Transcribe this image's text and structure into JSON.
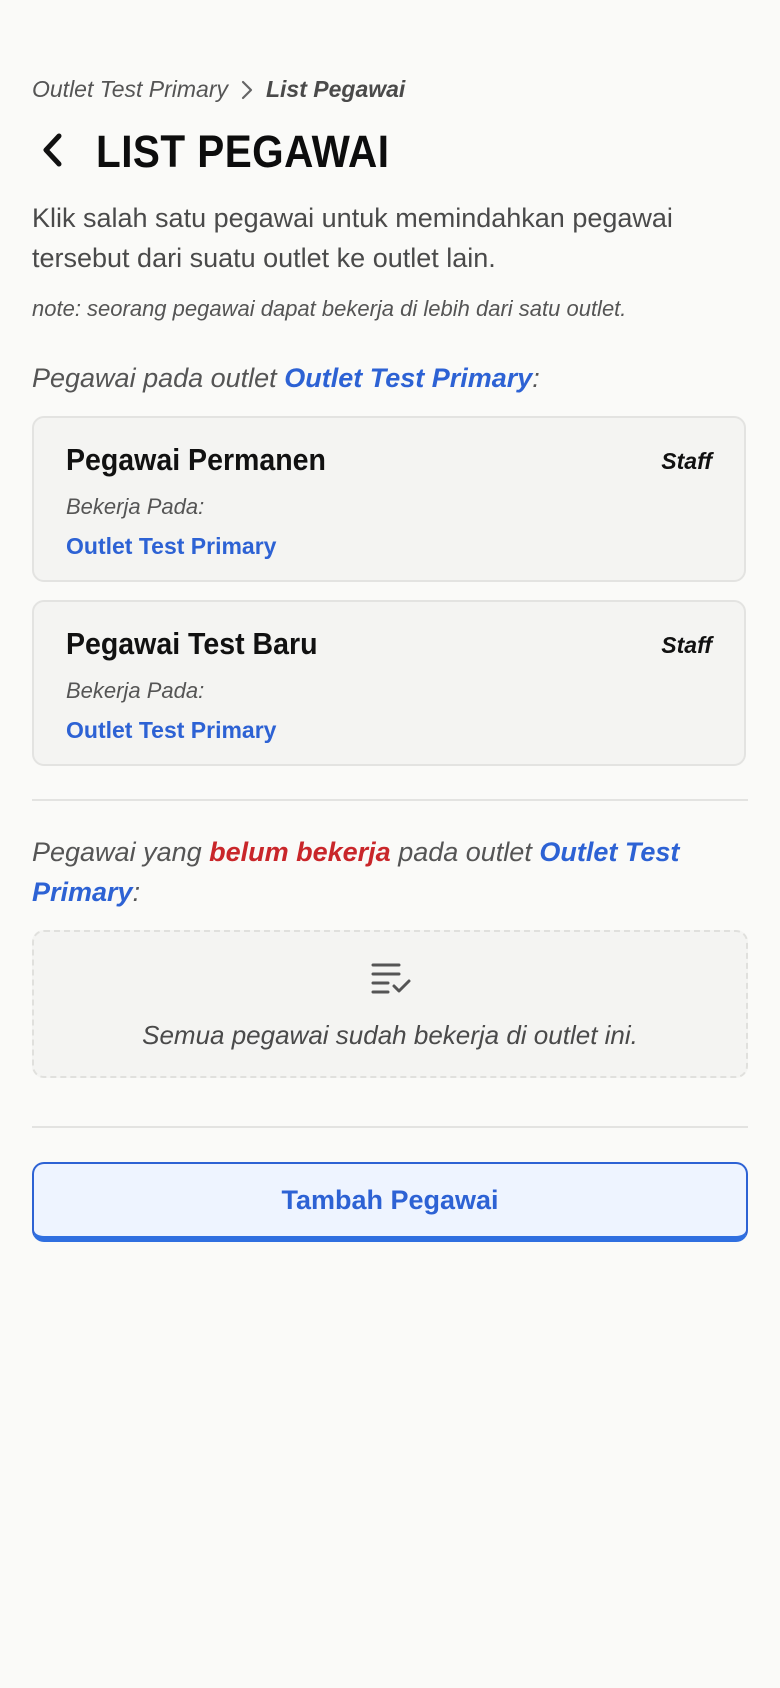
{
  "breadcrumb": {
    "items": [
      "Outlet Test Primary",
      "List Pegawai"
    ]
  },
  "header": {
    "title": "LIST PEGAWAI"
  },
  "description": "Klik salah satu pegawai untuk memindahkan pegawai tersebut dari suatu outlet ke outlet lain.",
  "note": "note: seorang pegawai dapat bekerja di lebih dari satu outlet.",
  "section_current": {
    "prefix": "Pegawai pada outlet ",
    "outlet": "Outlet Test Primary",
    "suffix": ":"
  },
  "employees": [
    {
      "name": "Pegawai Permanen",
      "role": "Staff",
      "works_label": "Bekerja Pada:",
      "works_outlet": "Outlet Test Primary"
    },
    {
      "name": "Pegawai Test Baru",
      "role": "Staff",
      "works_label": "Bekerja Pada:",
      "works_outlet": "Outlet Test Primary"
    }
  ],
  "section_not_working": {
    "prefix": "Pegawai yang ",
    "highlight": "belum bekerja",
    "middle": " pada outlet ",
    "outlet": "Outlet Test Primary",
    "suffix": ":"
  },
  "empty_state": {
    "icon": "list-check-icon",
    "message": "Semua pegawai sudah bekerja di outlet ini."
  },
  "actions": {
    "add_label": "Tambah Pegawai"
  },
  "colors": {
    "accent": "#2d62d4",
    "warning": "#c9262a",
    "card_bg": "#f4f4f2",
    "page_bg": "#fafaf8"
  }
}
